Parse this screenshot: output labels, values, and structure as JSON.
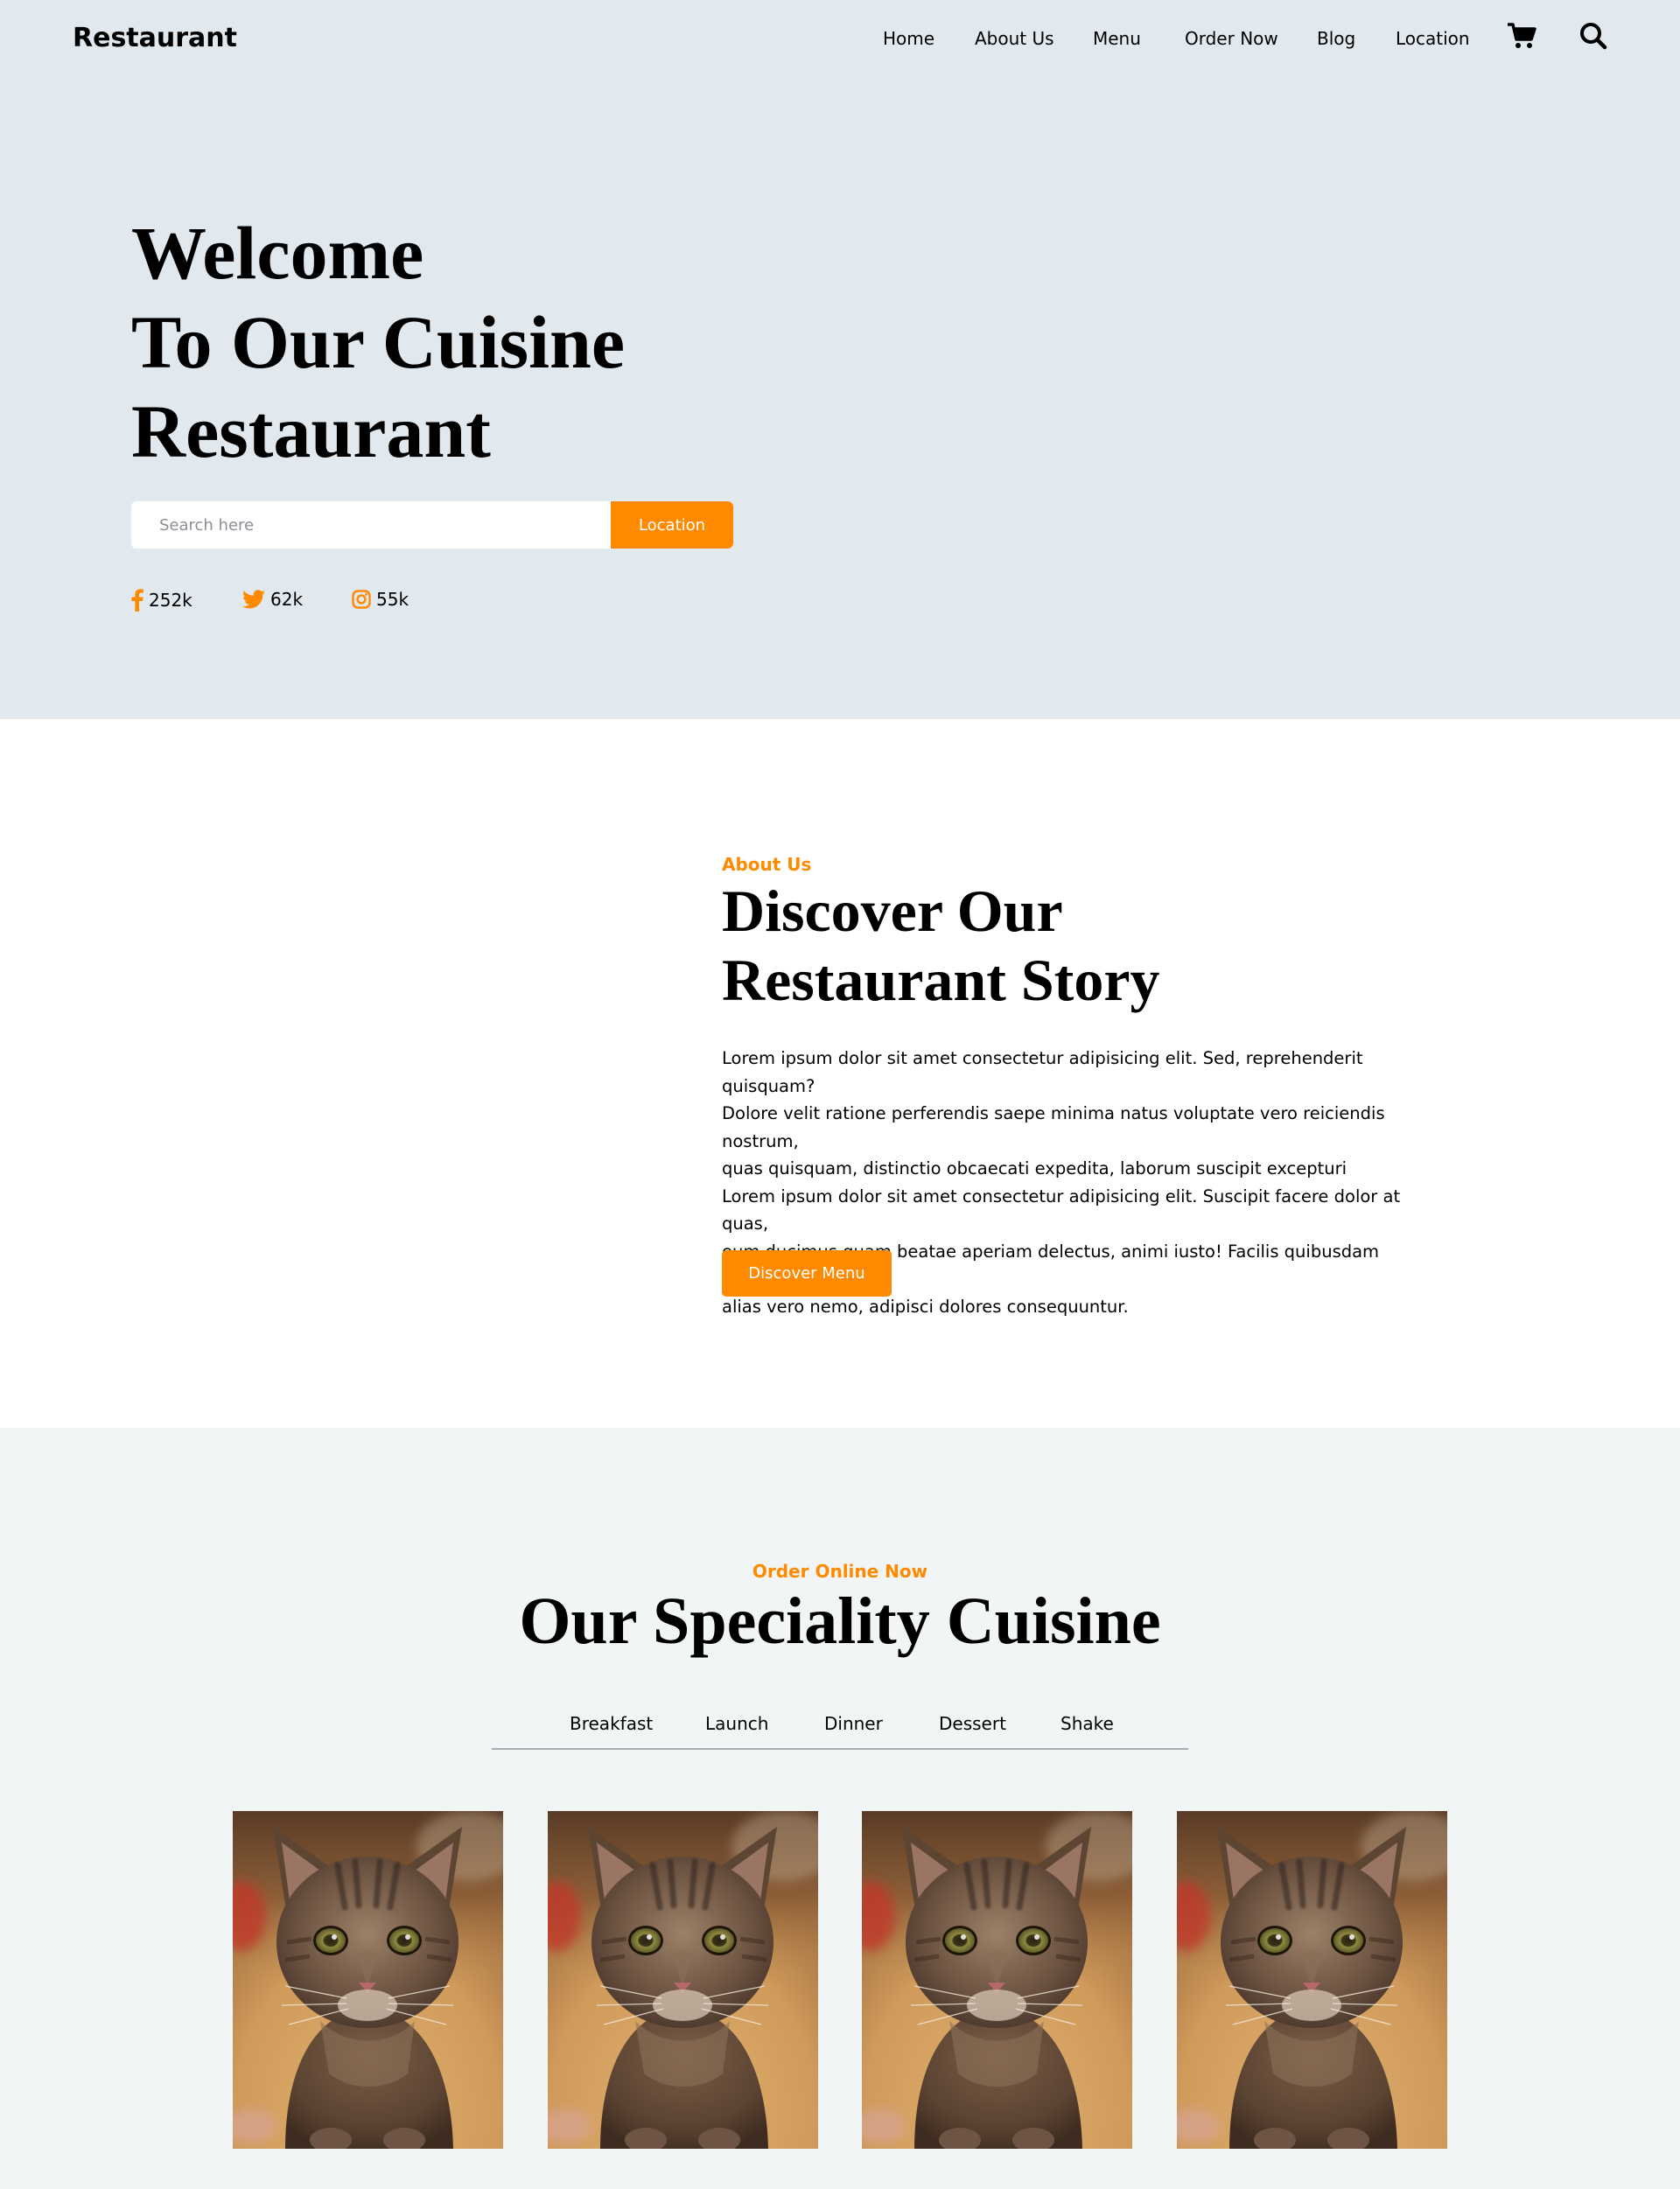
{
  "header": {
    "brand": "Restaurant",
    "nav": [
      "Home",
      "About Us",
      "Menu",
      "Order Now",
      "Blog",
      "Location"
    ],
    "icons": [
      "cart-icon",
      "search-icon"
    ]
  },
  "hero": {
    "title_lines": [
      "Welcome",
      "To Our Cuisine",
      "Restaurant"
    ],
    "search_placeholder": "Search here",
    "search_button": "Location",
    "socials": [
      {
        "icon": "facebook-icon",
        "count": "252k"
      },
      {
        "icon": "twitter-icon",
        "count": "62k"
      },
      {
        "icon": "instagram-icon",
        "count": "55k"
      }
    ]
  },
  "about": {
    "kicker": "About Us",
    "title_lines": [
      "Discover Our",
      "Restaurant Story"
    ],
    "text_lines": [
      "Lorem ipsum dolor sit amet consectetur adipisicing elit. Sed, reprehenderit quisquam?",
      "Dolore velit ratione perferendis saepe minima natus voluptate vero reiciendis nostrum,",
      "quas quisquam, distinctio obcaecati expedita, laborum suscipit excepturi",
      "Lorem ipsum dolor sit amet consectetur adipisicing elit. Suscipit facere dolor at quas,",
      "eum ducimus quam beatae aperiam delectus, animi iusto! Facilis quibusdam nesciunt",
      "alias vero nemo, adipisci dolores consequuntur."
    ],
    "button": "Discover Menu"
  },
  "speciality": {
    "kicker": "Order Online Now",
    "title": "Our Speciality Cuisine",
    "tabs": [
      "Breakfast",
      "Launch",
      "Dinner",
      "Dessert",
      "Shake"
    ],
    "cards": [
      {
        "image": "cat-photo"
      },
      {
        "image": "cat-photo"
      },
      {
        "image": "cat-photo"
      },
      {
        "image": "cat-photo"
      }
    ]
  },
  "colors": {
    "accent": "#ff8a00",
    "hero_bg": "#e1e8ee",
    "section_bg": "#f1f5f6"
  }
}
